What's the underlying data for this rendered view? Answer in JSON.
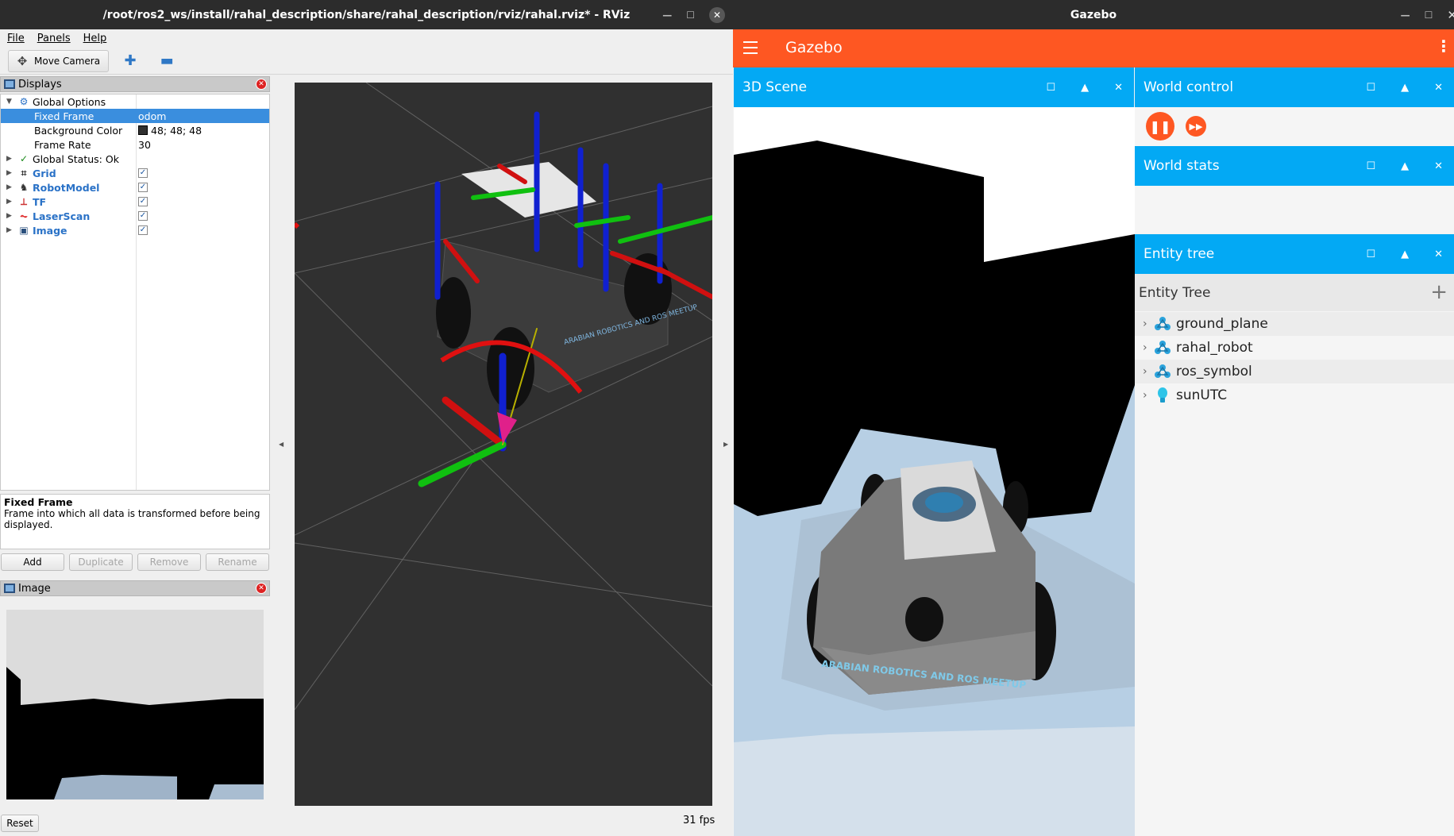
{
  "rviz": {
    "title": "/root/ros2_ws/install/rahal_description/share/rahal_description/rviz/rahal.rviz* - RViz",
    "menu": [
      "File",
      "Panels",
      "Help"
    ],
    "toolbar": {
      "move_camera": "Move Camera"
    },
    "displays_panel": {
      "title": "Displays",
      "rows": [
        {
          "name": "Global Options",
          "value": ""
        },
        {
          "name": "Fixed Frame",
          "value": "odom"
        },
        {
          "name": "Background Color",
          "value": "48; 48; 48"
        },
        {
          "name": "Frame Rate",
          "value": "30"
        },
        {
          "name": "Global Status: Ok",
          "value": ""
        },
        {
          "name": "Grid",
          "value": "✓"
        },
        {
          "name": "RobotModel",
          "value": "✓"
        },
        {
          "name": "TF",
          "value": "✓"
        },
        {
          "name": "LaserScan",
          "value": "✓"
        },
        {
          "name": "Image",
          "value": "✓"
        }
      ]
    },
    "description": {
      "title": "Fixed Frame",
      "text": "Frame into which all data is transformed before being displayed."
    },
    "buttons": {
      "add": "Add",
      "duplicate": "Duplicate",
      "remove": "Remove",
      "rename": "Rename"
    },
    "image_panel": {
      "title": "Image"
    },
    "reset": "Reset",
    "fps": "31 fps",
    "background_color": "#303030"
  },
  "gazebo": {
    "window_title": "Gazebo",
    "app_title": "Gazebo",
    "accent": "#fe5722",
    "panel_color": "#03a9f4",
    "scene_panel": {
      "title": "3D Scene"
    },
    "world_control": {
      "title": "World control"
    },
    "world_stats": {
      "title": "World stats"
    },
    "entity_tree": {
      "title": "Entity tree",
      "header": "Entity Tree",
      "entities": [
        "ground_plane",
        "rahal_robot",
        "ros_symbol",
        "sunUTC"
      ]
    },
    "robot_label": "ARABIAN ROBOTICS AND ROS MEETUP"
  },
  "rviz_robot_label": "ARABIAN ROBOTICS AND ROS MEETUP"
}
